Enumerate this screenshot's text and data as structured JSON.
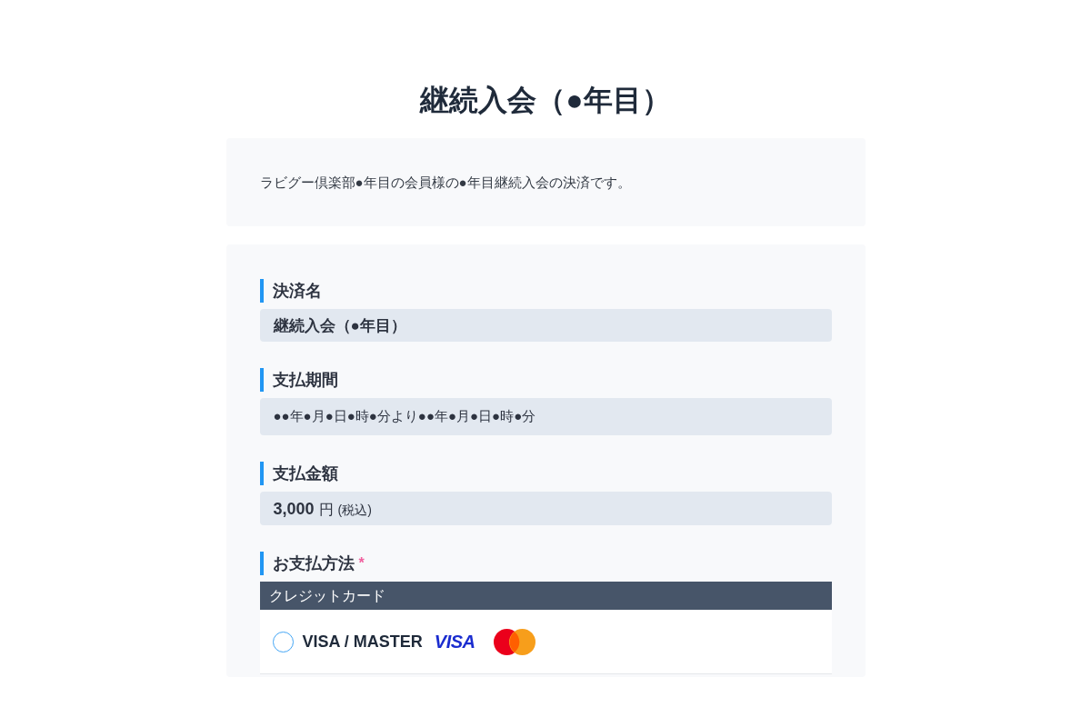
{
  "title": "継続入会（●年目）",
  "description": "ラビグー倶楽部●年目の会員様の●年目継続入会の決済です。",
  "fields": [
    {
      "kind": "name",
      "label": "決済名",
      "value": "継続入会（●年目）"
    },
    {
      "kind": "plain",
      "label": "支払期間",
      "value": "●●年●月●日●時●分より●●年●月●日●時●分"
    },
    {
      "kind": "amount",
      "label": "支払金額",
      "amount": "3,000",
      "unit": "円",
      "note": "(税込)"
    }
  ],
  "payment_method": {
    "label": "お支払方法",
    "required": true,
    "required_mark": "*",
    "group": "クレジットカード",
    "options": [
      {
        "label": "VISA / MASTER",
        "selected": false,
        "logos": [
          {
            "kind": "wordmark",
            "text": "VISA"
          },
          {
            "kind": "circles"
          }
        ]
      }
    ]
  }
}
